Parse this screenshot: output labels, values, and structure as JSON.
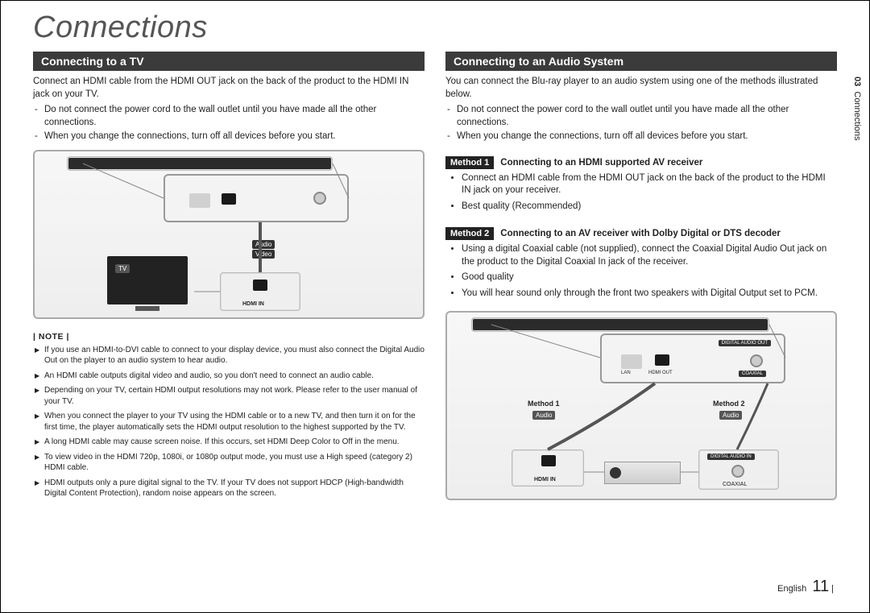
{
  "title": "Connections",
  "sideTab": {
    "num": "03",
    "label": "Connections"
  },
  "footer": {
    "lang": "English",
    "page": "11"
  },
  "left": {
    "heading": "Connecting to a TV",
    "intro": "Connect an HDMI cable from the HDMI OUT jack on the back of the product to the HDMI IN jack on your TV.",
    "warn1": "Do not connect the power cord to the wall outlet until you have made all the other connections.",
    "warn2": "When you change the connections, turn off all devices before you start.",
    "diag": {
      "audioVideo1": "Audio",
      "audioVideo2": "Video",
      "tv": "TV",
      "hdmiIn": "HDMI IN"
    },
    "noteLabel": "| NOTE |",
    "notes": [
      "If you use an HDMI-to-DVI cable to connect to your display device, you must also connect the Digital Audio Out on the player to an audio system to hear audio.",
      "An HDMI cable outputs digital video and audio, so you don't need to connect an audio cable.",
      "Depending on your TV, certain HDMI output resolutions may not work. Please refer to the user manual of your TV.",
      "When you connect the player to your TV using the HDMI cable or to a new TV, and then turn it on for the first time, the player automatically sets the HDMI output resolution to the highest supported by the TV.",
      "A long HDMI cable may cause screen noise. If this occurs, set HDMI Deep Color to Off in the menu.",
      "To view video in the HDMI 720p, 1080i, or 1080p output mode, you must use a High speed (category 2) HDMI cable.",
      "HDMI outputs only a pure digital signal to the TV.\nIf your TV does not support HDCP (High-bandwidth Digital Content Protection), random noise appears on the screen."
    ]
  },
  "right": {
    "heading": "Connecting to an Audio System",
    "intro": "You can connect the Blu-ray player to an audio system using one of the methods illustrated below.",
    "warn1": "Do not connect the power cord to the wall outlet until you have made all the other connections.",
    "warn2": "When you change the connections, turn off all devices before you start.",
    "m1": {
      "badge": "Method 1",
      "title": "Connecting to an HDMI supported AV receiver",
      "b1": "Connect an HDMI cable from the HDMI OUT jack on the back of the product to the HDMI IN jack on your receiver.",
      "b2": "Best quality (Recommended)"
    },
    "m2": {
      "badge": "Method 2",
      "title": "Connecting to an AV receiver with Dolby Digital or DTS decoder",
      "b1": "Using a digital Coaxial cable (not supplied), connect the Coaxial Digital Audio Out jack on the product to the Digital Coaxial In jack of the receiver.",
      "b2": "Good quality",
      "b3": "You will hear sound only through the front two speakers with Digital Output set to PCM."
    },
    "diag": {
      "method1": "Method 1",
      "method2": "Method 2",
      "audio1": "Audio",
      "audio2": "Audio",
      "hdmiIn": "HDMI IN",
      "digAudioIn": "DIGITAL AUDIO IN",
      "coaxial": "COAXIAL",
      "digAudioOut": "DIGITAL AUDIO OUT",
      "coaxOut": "COAXIAL",
      "lan": "LAN",
      "hdmiOut": "HDMI OUT"
    }
  }
}
